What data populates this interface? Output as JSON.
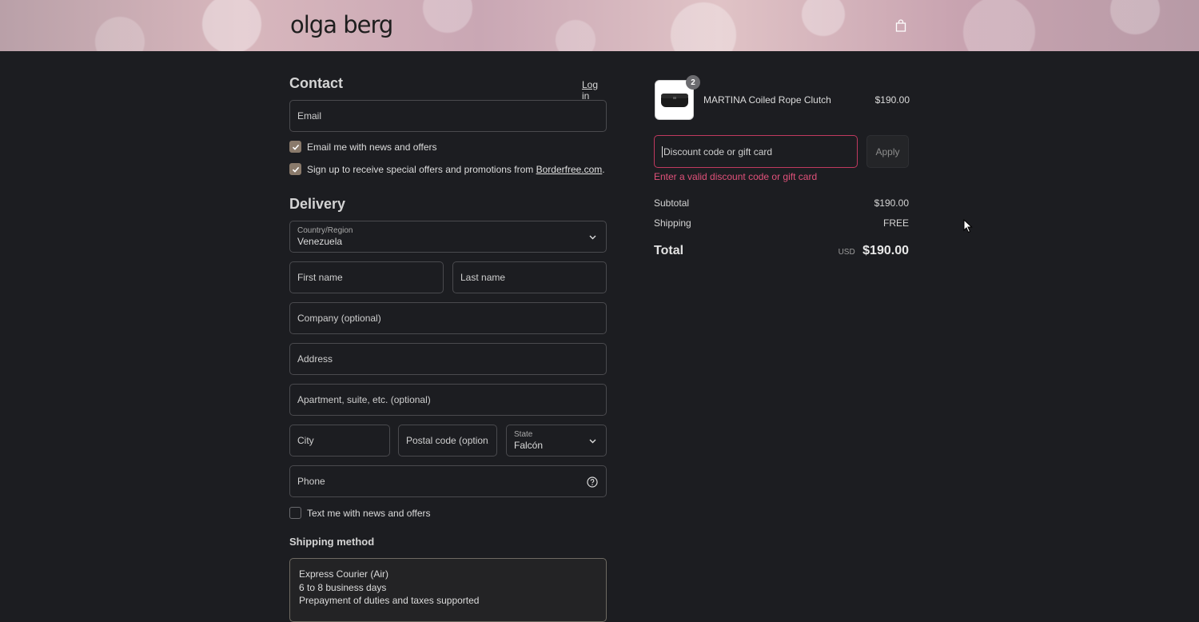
{
  "brand": {
    "logo": "olga berg"
  },
  "contact": {
    "title": "Contact",
    "login_label": "Log in",
    "email_placeholder": "Email",
    "news_checkbox": {
      "label": "Email me with news and offers",
      "checked": true
    },
    "offers_checkbox": {
      "label_prefix": "Sign up to receive special offers and promotions from ",
      "link": "Borderfree.com",
      "label_suffix": ".",
      "checked": true
    }
  },
  "delivery": {
    "title": "Delivery",
    "country": {
      "label": "Country/Region",
      "value": "Venezuela"
    },
    "first_name_placeholder": "First name",
    "last_name_placeholder": "Last name",
    "company_placeholder": "Company (optional)",
    "address_placeholder": "Address",
    "apartment_placeholder": "Apartment, suite, etc. (optional)",
    "city_placeholder": "City",
    "postal_placeholder": "Postal code (option...",
    "state": {
      "label": "State",
      "value": "Falcón"
    },
    "phone_placeholder": "Phone",
    "text_checkbox": {
      "label": "Text me with news and offers",
      "checked": false
    }
  },
  "shipping_method": {
    "title": "Shipping method",
    "option": {
      "name": "Express Courier (Air)",
      "duration": "6 to 8 business days",
      "note": "Prepayment of duties and taxes supported"
    }
  },
  "order": {
    "item": {
      "name": "MARTINA Coiled Rope Clutch",
      "price": "$190.00",
      "quantity": "2"
    },
    "discount_placeholder": "Discount code or gift card",
    "apply_label": "Apply",
    "error": "Enter a valid discount code or gift card",
    "subtotal_label": "Subtotal",
    "subtotal_value": "$190.00",
    "shipping_label": "Shipping",
    "shipping_value": "FREE",
    "total_label": "Total",
    "currency": "USD",
    "total_value": "$190.00"
  },
  "colors": {
    "error": "#e0517a",
    "error_border": "#c0395f",
    "checkbox": "#8a7a6b",
    "background": "#1c1d21"
  }
}
